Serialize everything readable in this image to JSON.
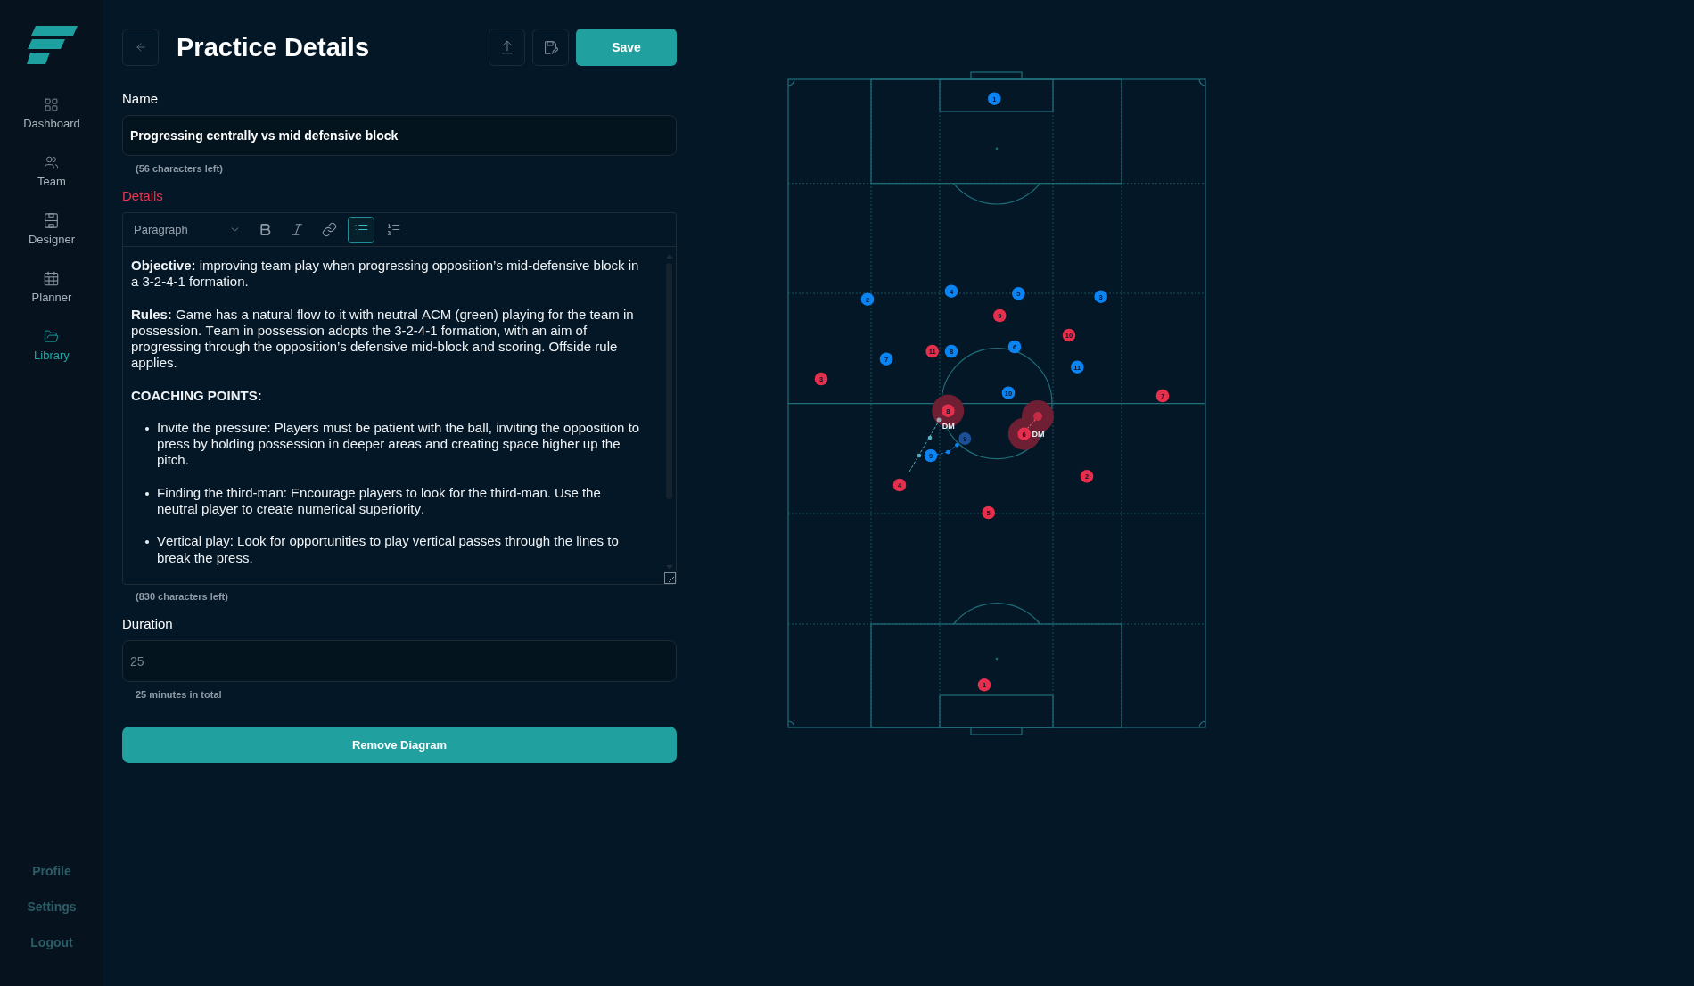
{
  "sidebar": {
    "nav": [
      {
        "label": "Dashboard",
        "selected": false
      },
      {
        "label": "Team",
        "selected": false
      },
      {
        "label": "Designer",
        "selected": false
      },
      {
        "label": "Planner",
        "selected": false
      },
      {
        "label": "Library",
        "selected": true
      }
    ],
    "footer_links": [
      "Profile",
      "Settings",
      "Logout"
    ]
  },
  "header": {
    "title": "Practice Details",
    "save_button": "Save"
  },
  "name_field": {
    "label": "Name",
    "value": "Progressing centrally vs mid defensive block",
    "hint": "(56 characters left)"
  },
  "details": {
    "label": "Details",
    "error": true,
    "block_type": "Paragraph",
    "tools": [
      {
        "kind": "bold",
        "active": false
      },
      {
        "kind": "italic",
        "active": false
      },
      {
        "kind": "link",
        "active": false
      },
      {
        "kind": "bullet_list",
        "active": true
      },
      {
        "kind": "ordered_list",
        "active": false
      }
    ],
    "content": [
      {
        "kind": "paragraph",
        "text": "**Objective:** improving team play when progressing opposition’s mid-defensive block in a 3-2-4-1 formation."
      },
      {
        "kind": "paragraph",
        "text": "**Rules:** Game has a natural flow to it with neutral ACM (green) playing for the team in possession. Team in possession adopts the 3-2-4-1 formation, with an aim of progressing through the opposition’s defensive mid-block and scoring. Offside rule applies."
      },
      {
        "kind": "heading",
        "text": "COACHING POINTS:"
      },
      {
        "kind": "bullets",
        "items": [
          "Invite the pressure: Players must be patient with the ball, inviting the opposition to press by holding possession in deeper areas and creating space higher up the pitch.",
          "Finding the third-man: Encourage players to look for the third-man. Use the neutral player to create numerical superiority.",
          "Vertical play: Look for opportunities to play vertical passes through the lines to break the press."
        ]
      }
    ],
    "hint": "(830 characters left)"
  },
  "duration_field": {
    "label": "Duration",
    "value": "25",
    "hint": "25 minutes in total"
  },
  "remove_button": "Remove Diagram",
  "diagram": {
    "players": [
      {
        "kind": "player",
        "number": "1",
        "color": "#0b84f3",
        "highlighted": false
      },
      {
        "kind": "player",
        "number": "4",
        "color": "#0b84f3",
        "highlighted": false
      },
      {
        "kind": "player",
        "number": "5",
        "color": "#0b84f3",
        "highlighted": false
      },
      {
        "kind": "player",
        "number": "3",
        "color": "#0b84f3",
        "highlighted": false
      },
      {
        "kind": "player",
        "number": "2",
        "color": "#0b84f3",
        "highlighted": false
      },
      {
        "kind": "player",
        "number": "9",
        "color": "#e62e4d",
        "highlighted": false
      },
      {
        "kind": "player",
        "number": "10",
        "color": "#e62e4d",
        "highlighted": false
      },
      {
        "kind": "player",
        "number": "6",
        "color": "#0b84f3",
        "highlighted": false
      },
      {
        "kind": "player",
        "number": "11",
        "color": "#e62e4d",
        "highlighted": false
      },
      {
        "kind": "player",
        "number": "8",
        "color": "#0b84f3",
        "highlighted": false
      },
      {
        "kind": "player",
        "number": "7",
        "color": "#0b84f3",
        "highlighted": false
      },
      {
        "kind": "player",
        "number": "11",
        "color": "#0b84f3",
        "highlighted": false
      },
      {
        "kind": "player",
        "number": "3",
        "color": "#e62e4d",
        "highlighted": false
      },
      {
        "kind": "player",
        "number": "10",
        "color": "#0b84f3",
        "highlighted": false
      },
      {
        "kind": "player",
        "number": "7",
        "color": "#e62e4d",
        "highlighted": false
      },
      {
        "kind": "player",
        "number": "8",
        "color": "#e62e4d",
        "highlighted": true,
        "role": "DM"
      },
      {
        "kind": "ghost",
        "color": "#c62a45",
        "highlighted": true
      },
      {
        "kind": "player",
        "number": "6",
        "color": "#e62e4d",
        "highlighted": true,
        "role": "DM"
      },
      {
        "kind": "ghost",
        "number": "9",
        "color": "#1d4f94",
        "highlighted": false
      },
      {
        "kind": "player",
        "number": "9",
        "color": "#0b84f3",
        "highlighted": false
      },
      {
        "kind": "player",
        "number": "2",
        "color": "#e62e4d",
        "highlighted": false
      },
      {
        "kind": "player",
        "number": "4",
        "color": "#e62e4d",
        "highlighted": false
      },
      {
        "kind": "player",
        "number": "5",
        "color": "#e62e4d",
        "highlighted": false
      },
      {
        "kind": "player",
        "number": "1",
        "color": "#e62e4d",
        "highlighted": false
      }
    ]
  }
}
